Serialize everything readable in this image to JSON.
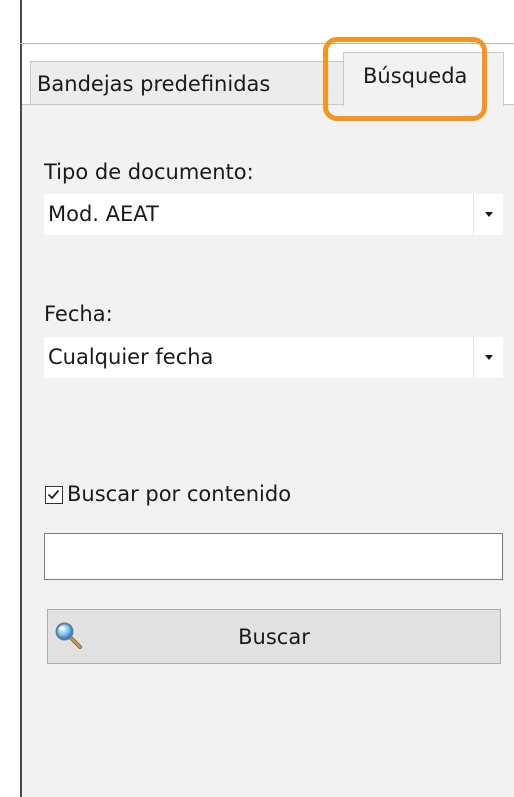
{
  "tabs": [
    {
      "label": "Bandejas predefinidas",
      "active": false
    },
    {
      "label": "Búsqueda",
      "active": true
    }
  ],
  "highlight": {
    "color": "#f7931e",
    "target": "tab-busqueda"
  },
  "form": {
    "doc_type": {
      "label": "Tipo de documento:",
      "value": "Mod. AEAT",
      "icon": "chevron-down-icon"
    },
    "date": {
      "label": "Fecha:",
      "value": "Cualquier fecha",
      "icon": "chevron-down-icon"
    },
    "content_search": {
      "label": "Buscar por contenido",
      "checked": true
    },
    "content_input": {
      "value": "",
      "placeholder": ""
    },
    "search_button": {
      "label": "Buscar",
      "icon": "magnifier-icon"
    }
  }
}
